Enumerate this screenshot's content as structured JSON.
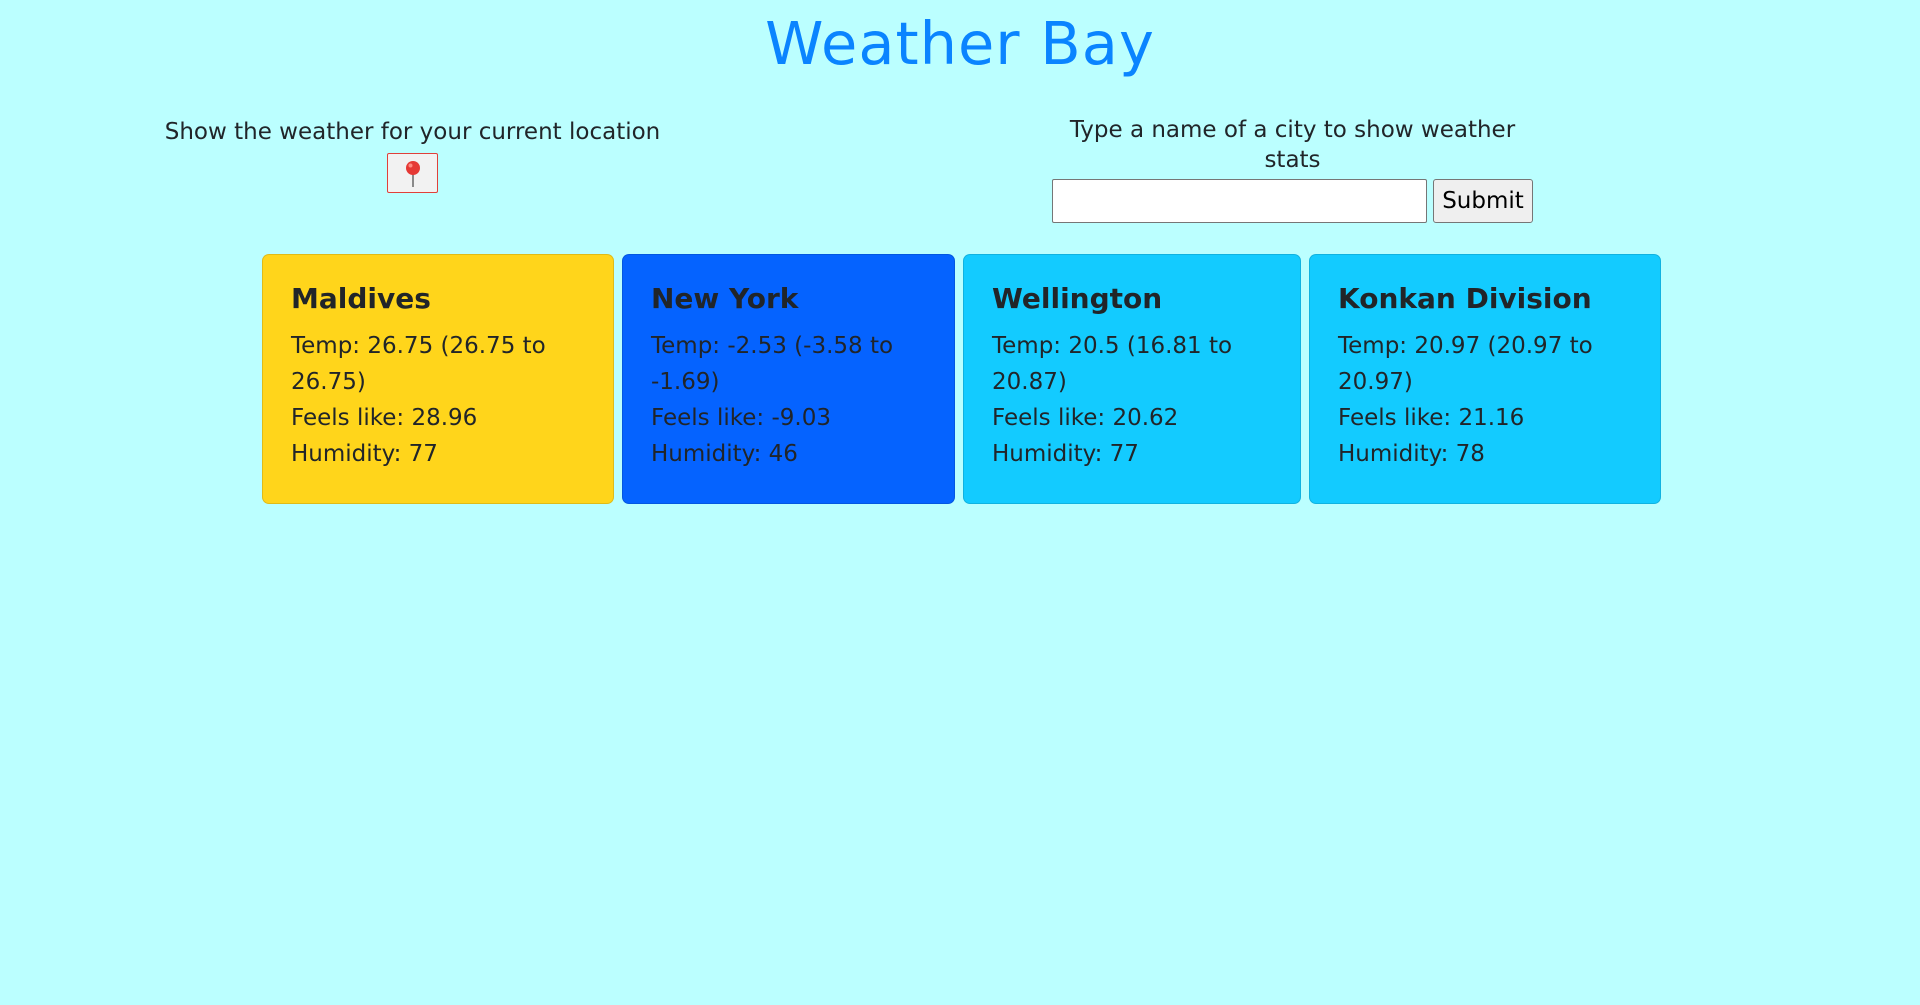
{
  "header": {
    "title": "Weather Bay"
  },
  "location": {
    "label": "Show the weather for your current location",
    "button_icon": "round-pushpin-icon",
    "button_border_color": "#e0403a"
  },
  "search": {
    "label": "Type a name of a city to show weather stats",
    "value": "",
    "placeholder": "",
    "submit_label": "Submit"
  },
  "cards": [
    {
      "city": "Maldives",
      "temp": "Temp: 26.75 (26.75 to 26.75)",
      "feels_like": "Feels like: 28.96",
      "humidity": "Humidity: 77",
      "color": "#ffd51b"
    },
    {
      "city": "New York",
      "temp": "Temp: -2.53 (-3.58 to -1.69)",
      "feels_like": "Feels like: -9.03",
      "humidity": "Humidity: 46",
      "color": "#0563ff"
    },
    {
      "city": "Wellington",
      "temp": "Temp: 20.5 (16.81 to 20.87)",
      "feels_like": "Feels like: 20.62",
      "humidity": "Humidity: 77",
      "color": "#13cbff"
    },
    {
      "city": "Konkan Division",
      "temp": "Temp: 20.97 (20.97 to 20.97)",
      "feels_like": "Feels like: 21.16",
      "humidity": "Humidity: 78",
      "color": "#13cbff"
    }
  ],
  "colors": {
    "page_background": "#bbffff",
    "title": "#0a84ff"
  }
}
